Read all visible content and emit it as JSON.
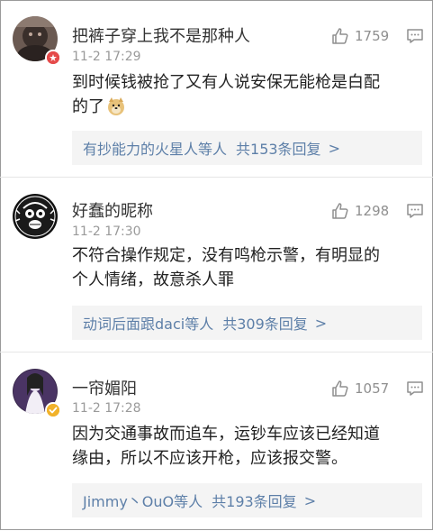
{
  "comments": [
    {
      "username": "把裤子穿上我不是那种人",
      "time": "11-2 17:29",
      "likes": "1759",
      "text_line1": "到时候钱被抢了又有人说安保无能枪是白配",
      "text_line2": "的了",
      "emoji_icon": "doge-emoji-icon",
      "badge_color": "#e54a4a",
      "reply_names": "有抄能力的火星人等人",
      "reply_count": "共153条回复",
      "reply_arrow": ">"
    },
    {
      "username": "好蠢的昵称",
      "time": "11-2 17:30",
      "likes": "1298",
      "text_line1": "不符合操作规定，没有鸣枪示警，有明显的",
      "text_line2": "个人情绪，故意杀人罪",
      "reply_names": "动词后面跟daci等人",
      "reply_count": "共309条回复",
      "reply_arrow": ">"
    },
    {
      "username": "一帘媚阳",
      "time": "11-2 17:28",
      "likes": "1057",
      "text_line1": "因为交通事故而追车，运钞车应该已经知道",
      "text_line2": "缘由，所以不应该开枪，应该报交警。",
      "badge_color": "#f1b22a",
      "reply_names": "Jimmy丶OuO等人",
      "reply_count": "共193条回复",
      "reply_arrow": ">"
    }
  ],
  "colors": {
    "link": "#5d7fa8",
    "meta": "#9a9a9a",
    "reply_bg": "#f4f4f4"
  }
}
